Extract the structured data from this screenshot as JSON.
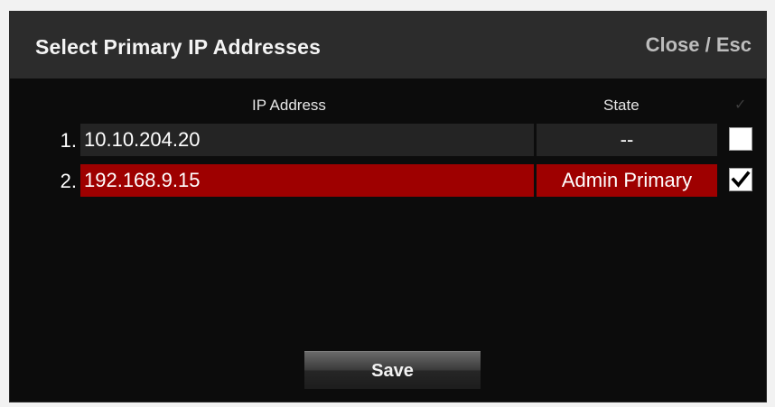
{
  "dialog": {
    "title": "Select Primary IP Addresses",
    "close_label": "Close / Esc"
  },
  "table": {
    "columns": {
      "ip": "IP Address",
      "state": "State",
      "check_icon": "checkmark-icon"
    },
    "rows": [
      {
        "number": "1.",
        "ip": "10.10.204.20",
        "state": "--",
        "checked": false,
        "selected": false
      },
      {
        "number": "2.",
        "ip": "192.168.9.15",
        "state": "Admin Primary",
        "checked": true,
        "selected": true
      }
    ]
  },
  "footer": {
    "save_label": "Save"
  },
  "colors": {
    "selected_row": "#9e0000",
    "row_background": "#242424",
    "dialog_background": "#0c0c0c",
    "titlebar_background": "#2c2c2c"
  }
}
